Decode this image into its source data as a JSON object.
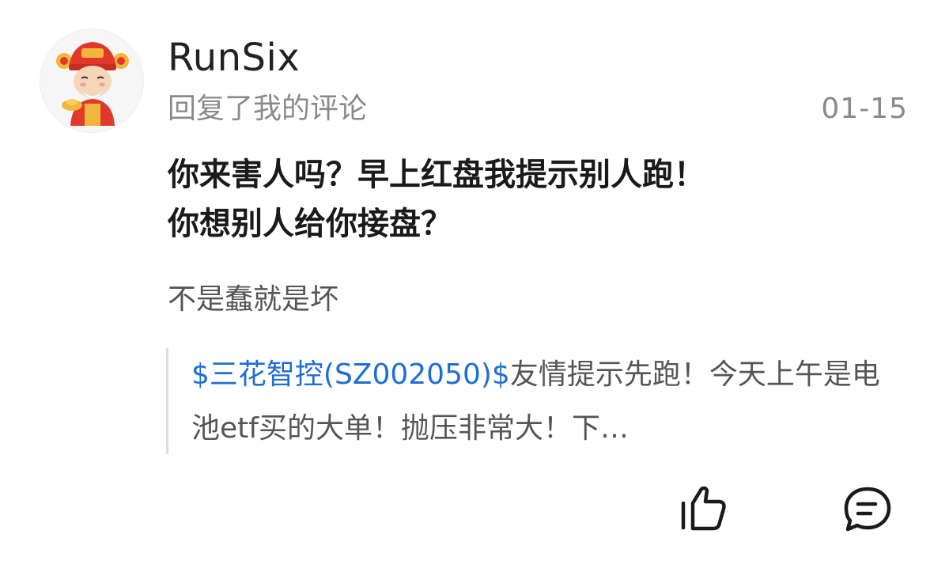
{
  "user": {
    "name": "RunSix",
    "avatar_icon": "caishen-avatar-icon"
  },
  "notification": {
    "action_text": "回复了我的评论",
    "timestamp": "01-15"
  },
  "reply": {
    "text": "你来害人吗？早上红盘我提示别人跑！\n你想别人给你接盘？"
  },
  "my_comment": {
    "text": "不是蠢就是坏"
  },
  "quoted_post": {
    "stock_link": "$三花智控(SZ002050)$",
    "text": "友情提示先跑！今天上午是电池etf买的大单！抛压非常大！下…"
  },
  "actions": {
    "like_icon": "thumbs-up-icon",
    "comment_icon": "comment-bubble-icon"
  },
  "colors": {
    "link": "#1f6fd1",
    "primary_text": "#1a1a1a",
    "secondary_text": "#8a8a8a",
    "quote_border": "#dddddd"
  }
}
